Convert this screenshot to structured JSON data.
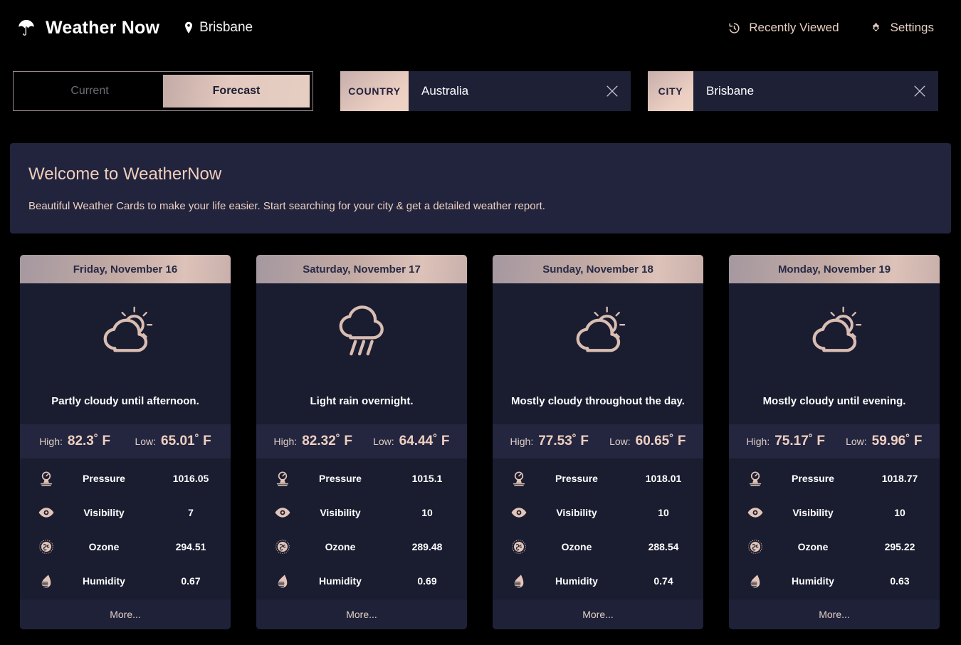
{
  "header": {
    "brand": "Weather Now",
    "logo_icon": "umbrella-icon",
    "location": "Brisbane",
    "location_icon": "map-pin-icon",
    "nav": [
      {
        "label": "Recently Viewed",
        "icon": "history-clock-icon"
      },
      {
        "label": "Settings",
        "icon": "gear-icon"
      }
    ]
  },
  "controls": {
    "toggle": {
      "current_label": "Current",
      "forecast_label": "Forecast",
      "selected": "Forecast"
    },
    "country": {
      "label": "COUNTRY",
      "value": "Australia",
      "placeholder": "Country",
      "clear_icon": "close-icon"
    },
    "city": {
      "label": "CITY",
      "value": "Brisbane",
      "placeholder": "City",
      "clear_icon": "close-icon"
    }
  },
  "welcome": {
    "title": "Welcome to WeatherNow",
    "subtitle": "Beautiful Weather Cards to make your life easier. Start searching for your city & get a detailed weather report."
  },
  "labels": {
    "high": "High:",
    "low": "Low:",
    "degree_unit": "˚ F",
    "more": "More..."
  },
  "colors": {
    "page_background": "#000000",
    "card_background": "#1a1c30",
    "banner_background": "#21243c",
    "accent_rose": "#e3c9bf",
    "accent_peach": "#f0cfc0",
    "header_text_dark": "#272a45"
  },
  "forecast_cards": [
    {
      "date": "Friday, November 16",
      "icon": "partly-cloudy-day-icon",
      "summary": "Partly cloudy until afternoon.",
      "high": "82.3",
      "low": "65.01",
      "metrics": [
        {
          "icon": "pressure-gauge-icon",
          "name": "Pressure",
          "value": "1016.05"
        },
        {
          "icon": "eye-icon",
          "name": "Visibility",
          "value": "7"
        },
        {
          "icon": "ozone-globe-icon",
          "name": "Ozone",
          "value": "294.51"
        },
        {
          "icon": "humidity-drop-icon",
          "name": "Humidity",
          "value": "0.67"
        }
      ]
    },
    {
      "date": "Saturday, November 17",
      "icon": "rain-icon",
      "summary": "Light rain overnight.",
      "high": "82.32",
      "low": "64.44",
      "metrics": [
        {
          "icon": "pressure-gauge-icon",
          "name": "Pressure",
          "value": "1015.1"
        },
        {
          "icon": "eye-icon",
          "name": "Visibility",
          "value": "10"
        },
        {
          "icon": "ozone-globe-icon",
          "name": "Ozone",
          "value": "289.48"
        },
        {
          "icon": "humidity-drop-icon",
          "name": "Humidity",
          "value": "0.69"
        }
      ]
    },
    {
      "date": "Sunday, November 18",
      "icon": "partly-cloudy-day-icon",
      "summary": "Mostly cloudy throughout the day.",
      "high": "77.53",
      "low": "60.65",
      "metrics": [
        {
          "icon": "pressure-gauge-icon",
          "name": "Pressure",
          "value": "1018.01"
        },
        {
          "icon": "eye-icon",
          "name": "Visibility",
          "value": "10"
        },
        {
          "icon": "ozone-globe-icon",
          "name": "Ozone",
          "value": "288.54"
        },
        {
          "icon": "humidity-drop-icon",
          "name": "Humidity",
          "value": "0.74"
        }
      ]
    },
    {
      "date": "Monday, November 19",
      "icon": "partly-cloudy-day-icon",
      "summary": "Mostly cloudy until evening.",
      "high": "75.17",
      "low": "59.96",
      "metrics": [
        {
          "icon": "pressure-gauge-icon",
          "name": "Pressure",
          "value": "1018.77"
        },
        {
          "icon": "eye-icon",
          "name": "Visibility",
          "value": "10"
        },
        {
          "icon": "ozone-globe-icon",
          "name": "Ozone",
          "value": "295.22"
        },
        {
          "icon": "humidity-drop-icon",
          "name": "Humidity",
          "value": "0.63"
        }
      ]
    }
  ]
}
